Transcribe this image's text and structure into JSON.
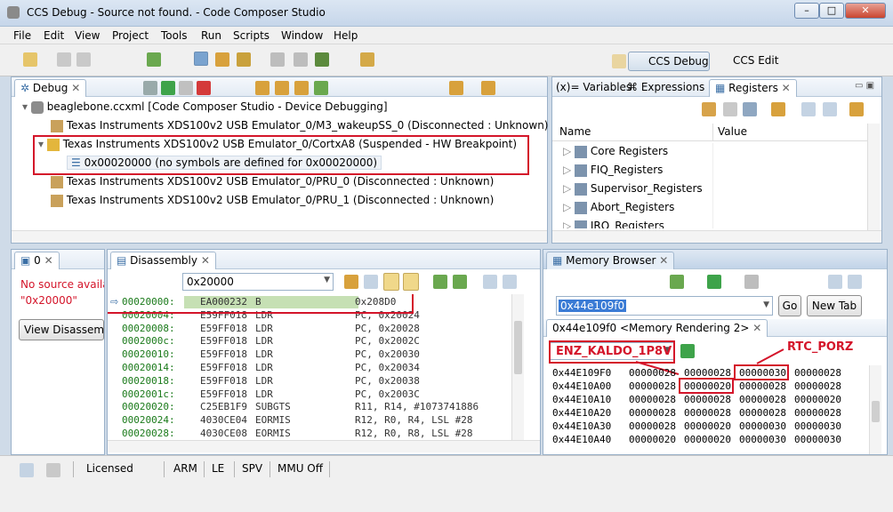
{
  "window": {
    "title": "CCS Debug - Source not found. - Code Composer Studio"
  },
  "menu": [
    "File",
    "Edit",
    "View",
    "Project",
    "Tools",
    "Run",
    "Scripts",
    "Window",
    "Help"
  ],
  "perspectives": {
    "debug": "CCS Debug",
    "edit": "CCS Edit"
  },
  "debug_view": {
    "tab": "Debug",
    "items": [
      {
        "label": "beaglebone.ccxml [Code Composer Studio - Device Debugging]"
      },
      {
        "label": "Texas Instruments XDS100v2 USB Emulator_0/M3_wakeupSS_0 (Disconnected : Unknown)"
      },
      {
        "label": "Texas Instruments XDS100v2 USB Emulator_0/CortxA8 (Suspended - HW Breakpoint)"
      },
      {
        "label": "0x00020000  (no symbols are defined for 0x00020000)"
      },
      {
        "label": "Texas Instruments XDS100v2 USB Emulator_0/PRU_0 (Disconnected : Unknown)"
      },
      {
        "label": "Texas Instruments XDS100v2 USB Emulator_0/PRU_1 (Disconnected : Unknown)"
      }
    ]
  },
  "registers_view": {
    "tabs": [
      "Variables",
      "Expressions",
      "Registers"
    ],
    "columns": [
      "Name",
      "Value"
    ],
    "rows": [
      "Core Registers",
      "FIQ_Registers",
      "Supervisor_Registers",
      "Abort_Registers",
      "IRQ_Registers"
    ]
  },
  "source_view": {
    "tab": "0",
    "message_line1": "No source availa",
    "message_line2": "\"0x20000\"",
    "button": "View Disassem"
  },
  "disassembly_view": {
    "tab": "Disassembly",
    "address_input": "0x20000",
    "rows": [
      {
        "addr": "00020000:",
        "hex": "EA000232",
        "op": "B",
        "args": "0x208D0"
      },
      {
        "addr": "00020004:",
        "hex": "E59FF018",
        "op": "LDR",
        "args": "PC, 0x20024"
      },
      {
        "addr": "00020008:",
        "hex": "E59FF018",
        "op": "LDR",
        "args": "PC, 0x20028"
      },
      {
        "addr": "0002000c:",
        "hex": "E59FF018",
        "op": "LDR",
        "args": "PC, 0x2002C"
      },
      {
        "addr": "00020010:",
        "hex": "E59FF018",
        "op": "LDR",
        "args": "PC, 0x20030"
      },
      {
        "addr": "00020014:",
        "hex": "E59FF018",
        "op": "LDR",
        "args": "PC, 0x20034"
      },
      {
        "addr": "00020018:",
        "hex": "E59FF018",
        "op": "LDR",
        "args": "PC, 0x20038"
      },
      {
        "addr": "0002001c:",
        "hex": "E59FF018",
        "op": "LDR",
        "args": "PC, 0x2003C"
      },
      {
        "addr": "00020020:",
        "hex": "C25EB1F9",
        "op": "SUBGTS",
        "args": "R11, R14, #1073741886"
      },
      {
        "addr": "00020024:",
        "hex": "4030CE04",
        "op": "EORMIS",
        "args": "R12, R0, R4, LSL #28"
      },
      {
        "addr": "00020028:",
        "hex": "4030CE08",
        "op": "EORMIS",
        "args": "R12, R0, R8, LSL #28"
      }
    ]
  },
  "memory_view": {
    "tab": "Memory Browser",
    "address_input": "0x44e109f0",
    "go_button": "Go",
    "new_tab_button": "New Tab",
    "rendering_tab": "0x44e109f0 <Memory Rendering 2>",
    "format_select": "",
    "annotations": {
      "left": "ENZ_KALDO_1P8V",
      "right": "RTC_PORZ"
    },
    "rows": [
      {
        "addr": "0x44E109F0",
        "words": [
          "00000028",
          "00000028",
          "00000030",
          "00000028"
        ]
      },
      {
        "addr": "0x44E10A00",
        "words": [
          "00000028",
          "00000020",
          "00000028",
          "00000028"
        ]
      },
      {
        "addr": "0x44E10A10",
        "words": [
          "00000028",
          "00000028",
          "00000028",
          "00000020"
        ]
      },
      {
        "addr": "0x44E10A20",
        "words": [
          "00000028",
          "00000028",
          "00000028",
          "00000028"
        ]
      },
      {
        "addr": "0x44E10A30",
        "words": [
          "00000028",
          "00000020",
          "00000030",
          "00000030"
        ]
      },
      {
        "addr": "0x44E10A40",
        "words": [
          "00000020",
          "00000020",
          "00000030",
          "00000030"
        ]
      }
    ]
  },
  "status": {
    "licensed": "Licensed",
    "items": [
      "ARM",
      "LE",
      "SPV",
      "MMU Off"
    ]
  }
}
